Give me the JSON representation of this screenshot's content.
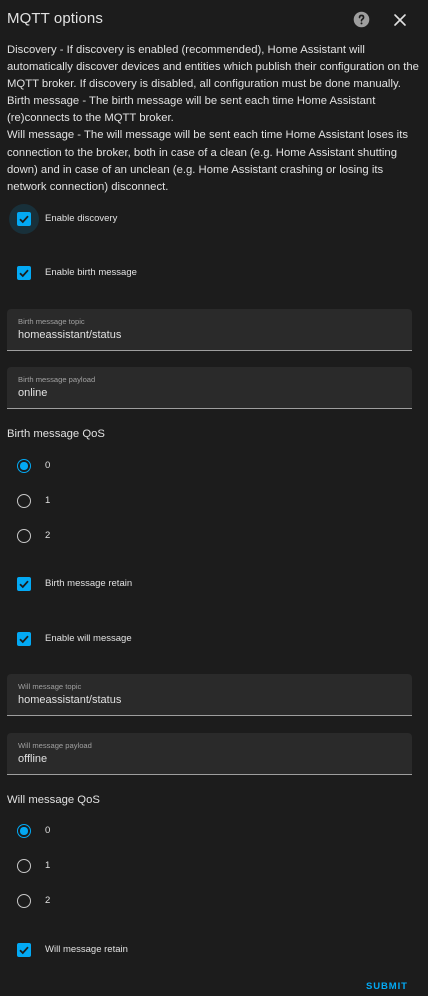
{
  "dialog": {
    "title": "MQTT options",
    "description": [
      "Discovery - If discovery is enabled (recommended), Home Assistant will automatically discover devices and entities which publish their configuration on the MQTT broker. If discovery is disabled, all configuration must be done manually.",
      "Birth message - The birth message will be sent each time Home Assistant (re)connects to the MQTT broker.",
      "Will message - The will message will be sent each time Home Assistant loses its connection to the broker, both in case of a clean (e.g. Home Assistant shutting down) and in case of an unclean (e.g. Home Assistant crashing or losing its network connection) disconnect."
    ],
    "submit_label": "SUBMIT"
  },
  "options": {
    "enable_discovery": {
      "label": "Enable discovery",
      "checked": true
    },
    "enable_birth": {
      "label": "Enable birth message",
      "checked": true
    },
    "birth_topic": {
      "label": "Birth message topic",
      "value": "homeassistant/status"
    },
    "birth_payload": {
      "label": "Birth message payload",
      "value": "online"
    },
    "birth_qos": {
      "title": "Birth message QoS",
      "options": [
        "0",
        "1",
        "2"
      ],
      "selected": "0"
    },
    "birth_retain": {
      "label": "Birth message retain",
      "checked": true
    },
    "enable_will": {
      "label": "Enable will message",
      "checked": true
    },
    "will_topic": {
      "label": "Will message topic",
      "value": "homeassistant/status"
    },
    "will_payload": {
      "label": "Will message payload",
      "value": "offline"
    },
    "will_qos": {
      "title": "Will message QoS",
      "options": [
        "0",
        "1",
        "2"
      ],
      "selected": "0"
    },
    "will_retain": {
      "label": "Will message retain",
      "checked": true
    }
  },
  "colors": {
    "background": "#1c1c1c",
    "accent": "#03a9f4",
    "field_background": "#2a2a2a"
  },
  "icons": {
    "help": "help-circle-icon",
    "close": "close-icon",
    "check": "check-icon"
  }
}
